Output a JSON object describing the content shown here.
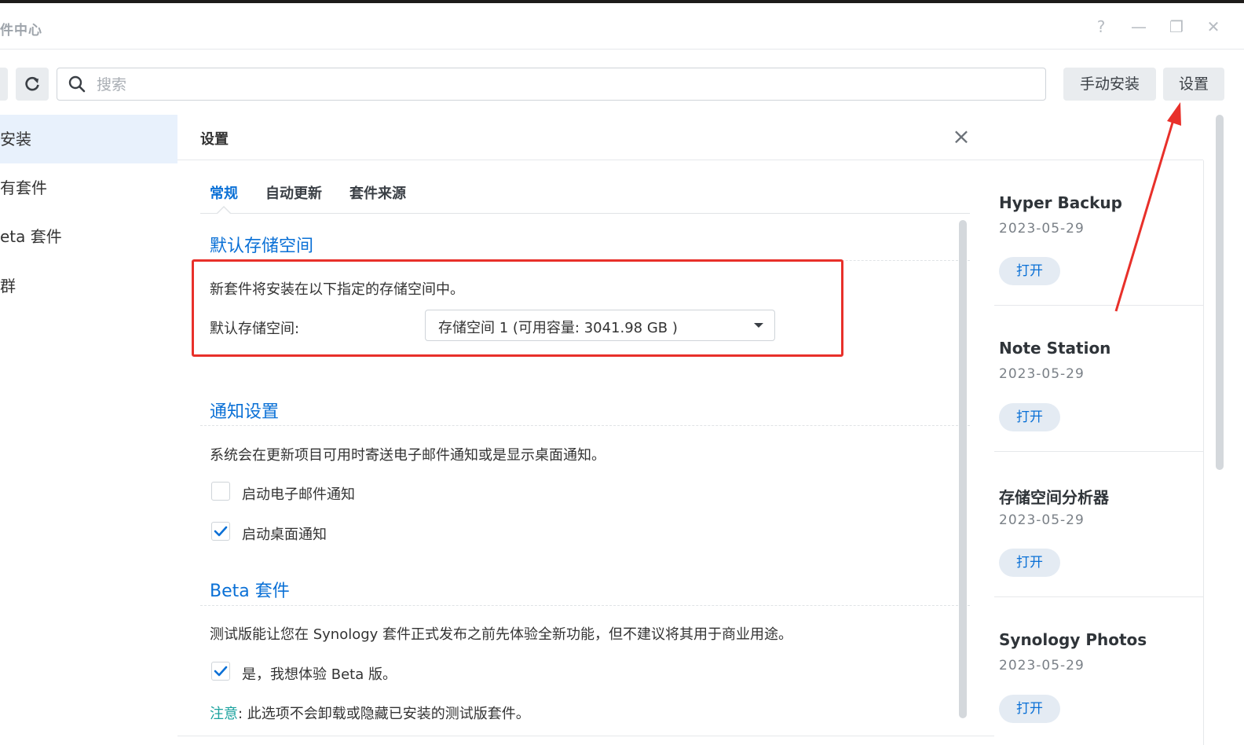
{
  "window": {
    "title": "件中心",
    "help_icon": "?",
    "minimize_icon": "—",
    "restore_icon": "❐",
    "close_icon": "✕"
  },
  "toolbar": {
    "search_placeholder": "搜索",
    "manual_install_label": "手动安装",
    "settings_label": "设置"
  },
  "sidebar": {
    "items": [
      {
        "label": "安装",
        "active": true
      },
      {
        "label": "有套件",
        "active": false
      },
      {
        "label": "eta 套件",
        "active": false
      },
      {
        "label": "群",
        "active": false
      }
    ]
  },
  "package_list": [
    {
      "name": "Hyper Backup",
      "date": "2023-05-29",
      "button": "打开"
    },
    {
      "name": "Note Station",
      "date": "2023-05-29",
      "button": "打开"
    },
    {
      "name": "存储空间分析器",
      "date": "2023-05-29",
      "button": "打开"
    },
    {
      "name": "Synology Photos",
      "date": "2023-05-29",
      "button": "打开"
    }
  ],
  "modal": {
    "title": "设置",
    "close_icon": "×",
    "tabs": [
      {
        "label": "常规",
        "active": true
      },
      {
        "label": "自动更新",
        "active": false
      },
      {
        "label": "套件来源",
        "active": false
      }
    ],
    "storage_section": {
      "title": "默认存储空间",
      "description": "新套件将安装在以下指定的存储空间中。",
      "field_label": "默认存储空间:",
      "selected_value": "存储空间 1 (可用容量:  3041.98 GB )"
    },
    "notify_section": {
      "title": "通知设置",
      "description": "系统会在更新项目可用时寄送电子邮件通知或是显示桌面通知。",
      "email_label": "启动电子邮件通知",
      "email_checked": false,
      "desktop_label": "启动桌面通知",
      "desktop_checked": true
    },
    "beta_section": {
      "title": "Beta 套件",
      "description": "测试版能让您在 Synology 套件正式发布之前先体验全新功能，但不建议将其用于商业用途。",
      "opt_in_label": "是，我想体验 Beta 版。",
      "opt_in_checked": true,
      "note_label": "注意",
      "note_text": ": 此选项不会卸载或隐藏已安装的测试版套件。"
    }
  },
  "colors": {
    "accent": "#0a70d6",
    "highlight_annotation": "#e8302a",
    "note_teal": "#1ba29e"
  }
}
